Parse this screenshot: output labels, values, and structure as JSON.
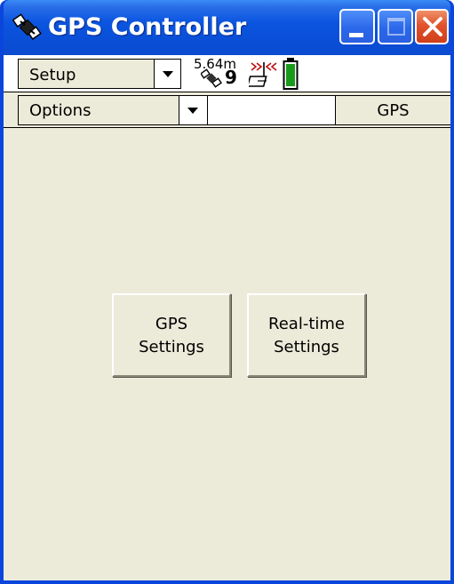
{
  "window": {
    "title": "GPS Controller",
    "icons": {
      "app": "satellite-app-icon",
      "minimize": "minimize-icon",
      "maximize": "maximize-icon",
      "close": "close-icon"
    }
  },
  "toolbar": {
    "setup_label": "Setup",
    "setup_icon": "chevron-down-icon",
    "status": {
      "precision": "5.64m",
      "satellites": "9",
      "icons": [
        "satellite-icon",
        "radio-link-icon",
        "battery-icon"
      ]
    },
    "options_label": "Options",
    "mode_tab": "GPS"
  },
  "main": {
    "buttons": [
      {
        "line1": "GPS",
        "line2": "Settings"
      },
      {
        "line1": "Real-time",
        "line2": "Settings"
      }
    ]
  },
  "colors": {
    "titlebar": "#0a55e0",
    "client_background": "#ecead9",
    "close_button": "#e0522c",
    "battery": "#1a9a1a",
    "radio_signal": "#c01010"
  }
}
